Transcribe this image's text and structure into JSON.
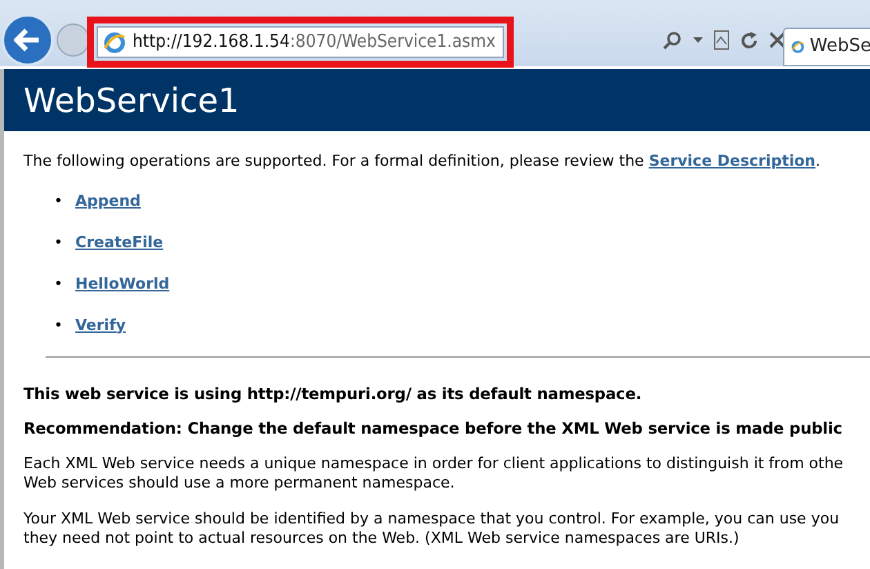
{
  "browser": {
    "address": {
      "host": "http://192.168.1.54",
      "rest": ":8070/WebService1.asmx"
    },
    "tab": {
      "label": "WebSe",
      "selected": true
    }
  },
  "page": {
    "title": "WebService1",
    "intro": {
      "text": "The following operations are supported. For a formal definition, please review the",
      "link": "Service Description",
      "end": "."
    },
    "operations": [
      {
        "bullet": "•",
        "label": "Append"
      },
      {
        "bullet": "•",
        "label": "CreateFile"
      },
      {
        "bullet": "•",
        "label": "HelloWorld"
      },
      {
        "bullet": "•",
        "label": "Verify"
      }
    ],
    "headings": [
      "This web service is using http://tempuri.org/ as its default namespace.",
      "Recommendation: Change the default namespace before the XML Web service is made public"
    ],
    "paragraphs": [
      [
        "Each XML Web service needs a unique namespace in order for client applications to distinguish it from othe",
        "Web services should use a more permanent namespace."
      ],
      [
        "Your XML Web service should be identified by a namespace that you control. For example, you can use you",
        "they need not point to actual resources on the Web. (XML Web service namespaces are URIs.)"
      ]
    ]
  }
}
